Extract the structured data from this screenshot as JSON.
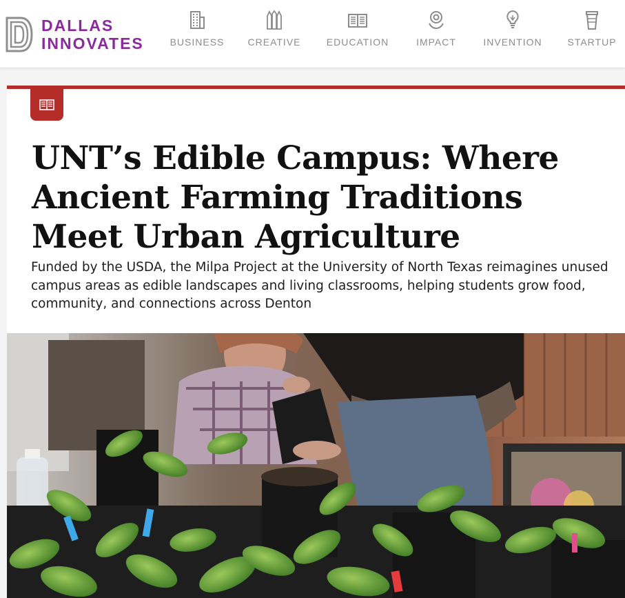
{
  "site": {
    "logo_line1": "DALLAS",
    "logo_line2": "INNOVATES",
    "brand_color": "#8a2a9c"
  },
  "nav": [
    {
      "label": "BUSINESS",
      "icon": "building-icon"
    },
    {
      "label": "CREATIVE",
      "icon": "pencils-icon"
    },
    {
      "label": "EDUCATION",
      "icon": "book-icon"
    },
    {
      "label": "IMPACT",
      "icon": "target-hands-icon"
    },
    {
      "label": "INVENTION",
      "icon": "lightbulb-icon"
    },
    {
      "label": "STARTUP",
      "icon": "cup-icon"
    }
  ],
  "article": {
    "category_icon": "open-book-icon",
    "accent_color": "#b52d28",
    "title": "UNT’s Edible Campus: Where Ancient Farming Traditions Meet Urban Agriculture",
    "dek": "Funded by the USDA, the Milpa Project at the University of North Texas reimagines unused campus areas as edible landscapes and living classrooms, helping students grow food, community, and connections across Denton",
    "hero_image": "students-potting-pepper-seedlings-photo"
  }
}
